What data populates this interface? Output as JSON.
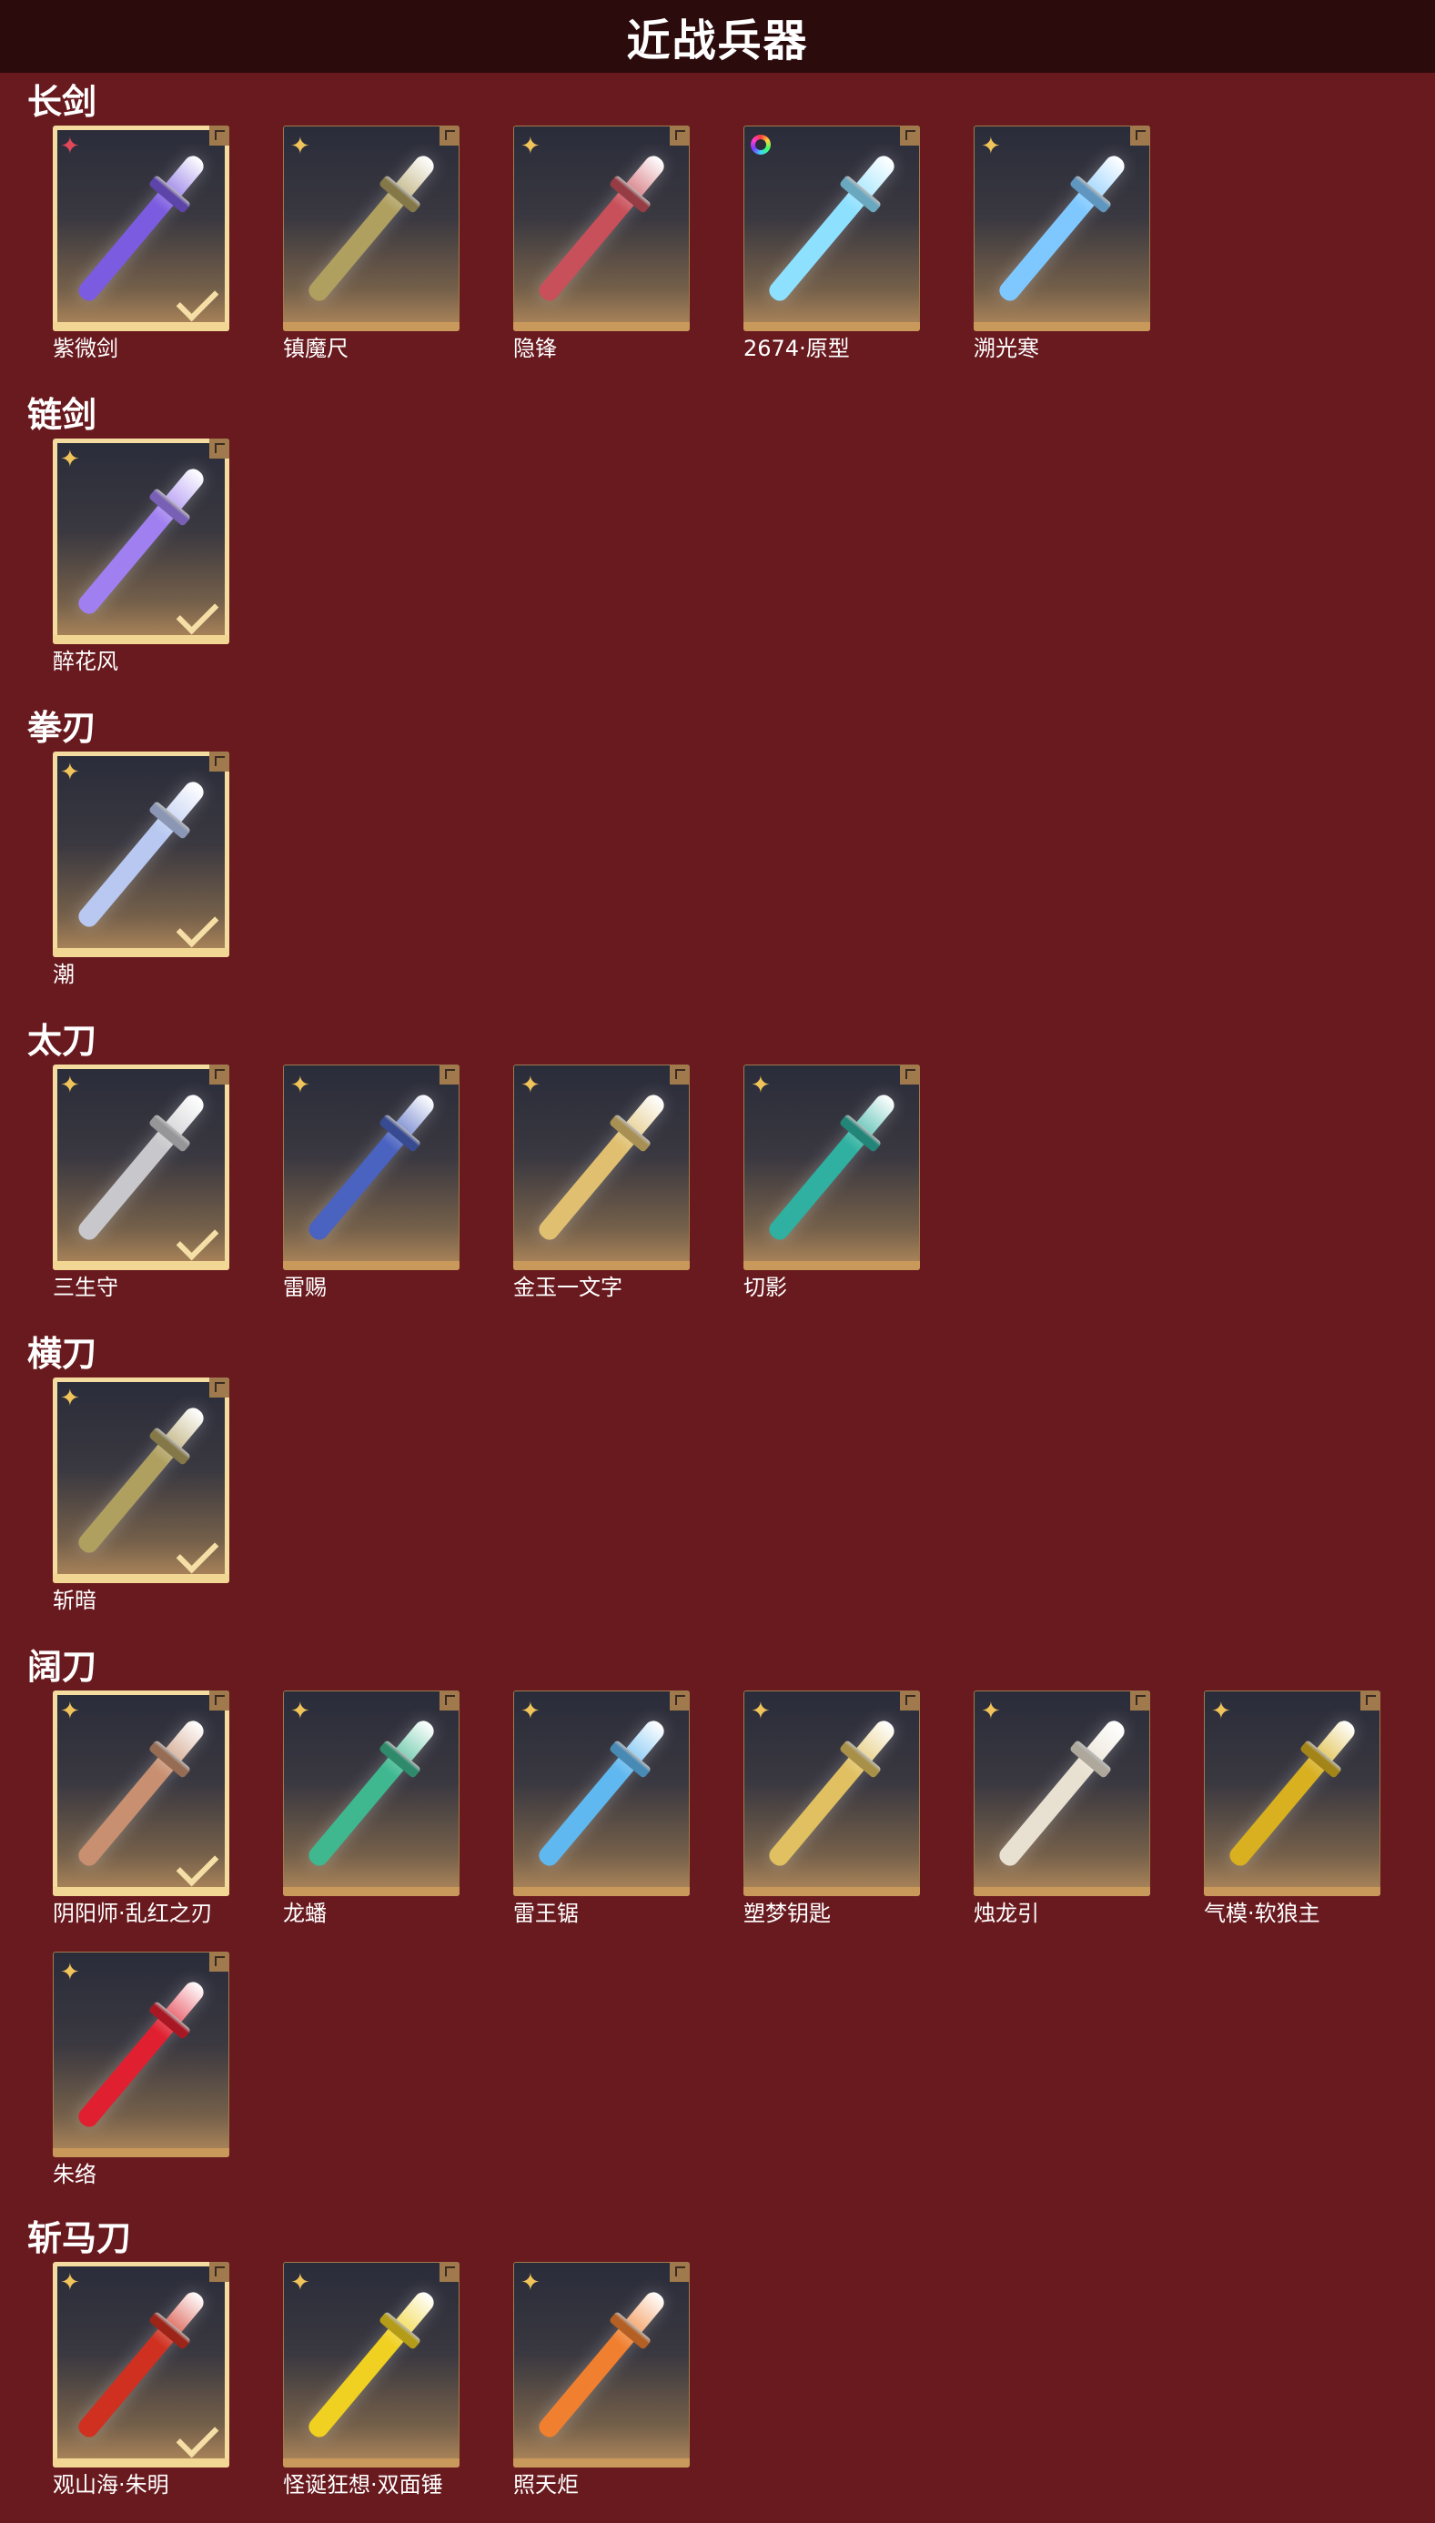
{
  "header": {
    "title": "近战兵器"
  },
  "sections": [
    {
      "title": "长剑",
      "items": [
        {
          "name": "紫微剑",
          "badge": "red",
          "selected": true,
          "color": "#7b5be0"
        },
        {
          "name": "镇魔尺",
          "badge": "gold",
          "selected": false,
          "color": "#b0a060"
        },
        {
          "name": "隐锋",
          "badge": "gold",
          "selected": false,
          "color": "#c8505a"
        },
        {
          "name": "2674·原型",
          "badge": "ring",
          "selected": false,
          "color": "#8ee0ff"
        },
        {
          "name": "溯光寒",
          "badge": "gold",
          "selected": false,
          "color": "#7fc8ff"
        }
      ]
    },
    {
      "title": "链剑",
      "items": [
        {
          "name": "醉花风",
          "badge": "gold",
          "selected": true,
          "color": "#a080f0"
        }
      ]
    },
    {
      "title": "拳刃",
      "items": [
        {
          "name": "潮",
          "badge": "gold",
          "selected": true,
          "color": "#b8c8f0"
        }
      ]
    },
    {
      "title": "太刀",
      "items": [
        {
          "name": "三生守",
          "badge": "gold",
          "selected": true,
          "color": "#c8c8cc"
        },
        {
          "name": "雷赐",
          "badge": "gold",
          "selected": false,
          "color": "#4a62c0"
        },
        {
          "name": "金玉一文字",
          "badge": "gold",
          "selected": false,
          "color": "#e0c070"
        },
        {
          "name": "切影",
          "badge": "gold",
          "selected": false,
          "color": "#2fb0a0"
        }
      ]
    },
    {
      "title": "横刀",
      "items": [
        {
          "name": "斩暗",
          "badge": "gold",
          "selected": true,
          "color": "#b0a060"
        }
      ]
    },
    {
      "title": "阔刀",
      "items": [
        {
          "name": "阴阳师·乱红之刃",
          "badge": "gold",
          "selected": true,
          "color": "#c89070"
        },
        {
          "name": "龙蟠",
          "badge": "gold",
          "selected": false,
          "color": "#3fb890"
        },
        {
          "name": "雷王锯",
          "badge": "gold",
          "selected": false,
          "color": "#60b8f0"
        },
        {
          "name": "塑梦钥匙",
          "badge": "gold",
          "selected": false,
          "color": "#e0c060"
        },
        {
          "name": "烛龙引",
          "badge": "gold",
          "selected": false,
          "color": "#e8e0d0"
        },
        {
          "name": "气模·软狼主",
          "badge": "gold",
          "selected": false,
          "color": "#d8b020"
        },
        {
          "name": "朱络",
          "badge": "gold",
          "selected": false,
          "color": "#e02030"
        }
      ]
    },
    {
      "title": "斩马刀",
      "items": [
        {
          "name": "观山海·朱明",
          "badge": "gold",
          "selected": true,
          "color": "#d03020"
        },
        {
          "name": "怪诞狂想·双面锤",
          "badge": "gold",
          "selected": false,
          "color": "#f0d020"
        },
        {
          "name": "照天炬",
          "badge": "gold",
          "selected": false,
          "color": "#f08030"
        }
      ]
    }
  ]
}
